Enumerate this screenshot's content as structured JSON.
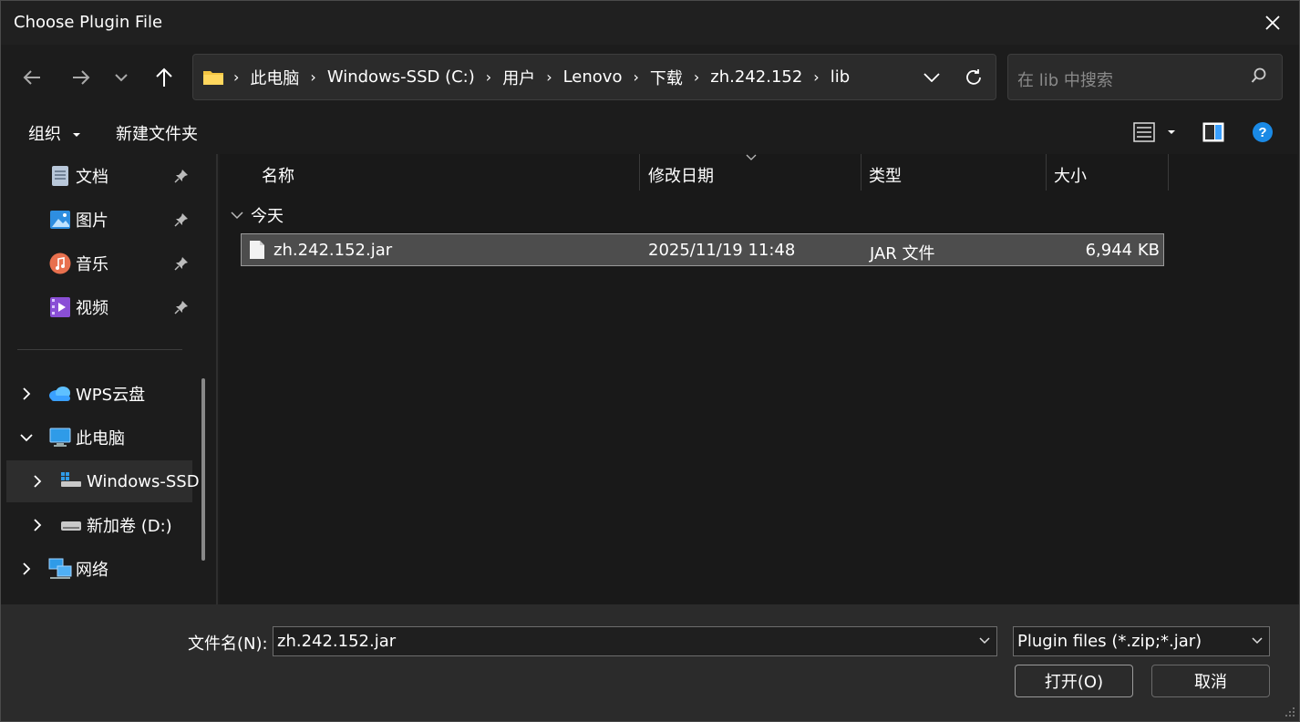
{
  "window": {
    "title": "Choose Plugin File"
  },
  "nav": {
    "breadcrumbs": [
      "此电脑",
      "Windows-SSD (C:)",
      "用户",
      "Lenovo",
      "下载",
      "zh.242.152",
      "lib"
    ],
    "search_placeholder": "在 lib 中搜索"
  },
  "toolbar": {
    "organize_label": "组织",
    "new_folder_label": "新建文件夹"
  },
  "sidebar": {
    "quick_access": [
      {
        "label": "文档",
        "icon": "document-icon"
      },
      {
        "label": "图片",
        "icon": "picture-icon"
      },
      {
        "label": "音乐",
        "icon": "music-icon"
      },
      {
        "label": "视频",
        "icon": "video-icon"
      }
    ],
    "tree": [
      {
        "label": "WPS云盘",
        "icon": "cloud-icon"
      },
      {
        "label": "此电脑",
        "icon": "computer-icon"
      },
      {
        "label": "Windows-SSD",
        "icon": "drive-icon"
      },
      {
        "label": "新加卷 (D:)",
        "icon": "drive-icon"
      },
      {
        "label": "网络",
        "icon": "network-icon"
      }
    ]
  },
  "list": {
    "columns": [
      "名称",
      "修改日期",
      "类型",
      "大小"
    ],
    "group_label": "今天",
    "files": [
      {
        "name": "zh.242.152.jar",
        "modified": "2025/11/19 11:48",
        "type": "JAR 文件",
        "size": "6,944 KB"
      }
    ]
  },
  "bottom": {
    "filename_label": "文件名(N):",
    "filename_value": "zh.242.152.jar",
    "filetype_value": "Plugin files (*.zip;*.jar)",
    "open_label": "打开(O)",
    "cancel_label": "取消"
  },
  "colors": {
    "accent": "#0078d4",
    "folder": "#f4c542"
  }
}
